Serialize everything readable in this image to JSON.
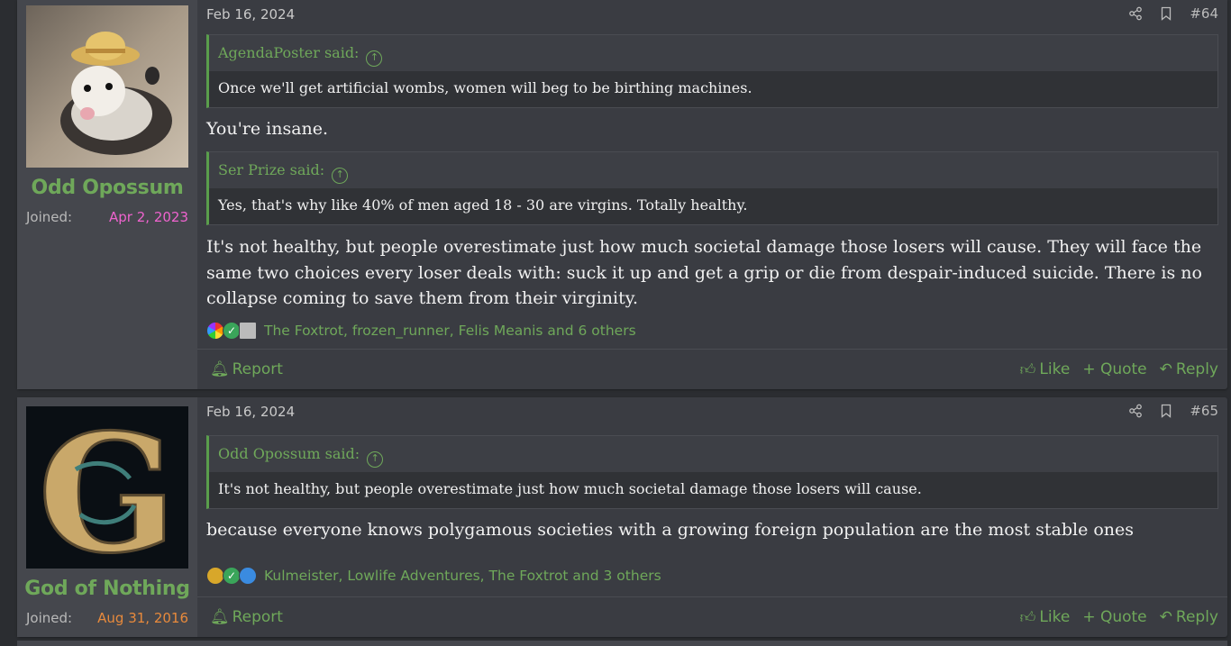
{
  "posts": [
    {
      "user": {
        "name": "Odd Opossum",
        "joined_label": "Joined:",
        "joined_date": "Apr 2, 2023"
      },
      "date": "Feb 16, 2024",
      "number": "#64",
      "quotes": [
        {
          "author": "AgendaPoster said:",
          "text": "Once we'll get artificial wombs, women will beg to be birthing machines."
        },
        {
          "author": "Ser Prize said:",
          "text": "Yes, that's why like 40% of men aged 18 - 30 are virgins. Totally healthy."
        }
      ],
      "reply1": "You're insane.",
      "reply2": "It's not healthy, but people overestimate just how much societal damage those losers will cause. They will face the same two choices every loser deals with: suck it up and get a grip or die from despair-induced suicide. There is no collapse coming to save them from their virginity.",
      "reactions": "The Foxtrot, frozen_runner, Felis Meanis and 6 others",
      "reaction_icons": [
        "rainbow-icon",
        "checkmark-icon",
        "scroll-icon"
      ]
    },
    {
      "user": {
        "name": "God of Nothing",
        "joined_label": "Joined:",
        "joined_date": "Aug 31, 2016"
      },
      "date": "Feb 16, 2024",
      "number": "#65",
      "quotes": [
        {
          "author": "Odd Opossum said:",
          "text": "It's not healthy, but people overestimate just how much societal damage those losers will cause."
        }
      ],
      "reply1": "because everyone knows polygamous societies with a growing foreign population are the most stable ones",
      "reactions": "Kulmeister, Lowlife Adventures, The Foxtrot and 3 others",
      "reaction_icons": [
        "medal-icon",
        "checkmark-icon",
        "thumbs-up-icon"
      ]
    }
  ],
  "actions": {
    "report": "Report",
    "like": "Like",
    "quote": "+ Quote",
    "reply": "Reply"
  },
  "colors": {
    "accent": "#6fa85a",
    "post_bg": "#3a3c42",
    "user_bg": "#45474d",
    "page_bg": "#2b2d31",
    "joined_pink": "#ee63ce",
    "joined_orange": "#e88a3c"
  }
}
